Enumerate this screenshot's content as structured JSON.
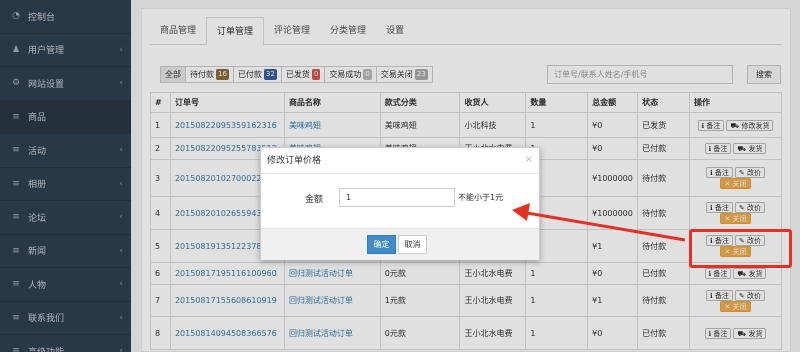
{
  "sidebar": {
    "items": [
      {
        "icon": "◔",
        "label": "控制台",
        "chevron": ""
      },
      {
        "icon": "♟",
        "label": "用户管理",
        "chevron": "‹"
      },
      {
        "icon": "⚙",
        "label": "网站设置",
        "chevron": "‹"
      },
      {
        "icon": "≡",
        "label": "商品",
        "chevron": ""
      },
      {
        "icon": "≡",
        "label": "活动",
        "chevron": "‹"
      },
      {
        "icon": "≡",
        "label": "相册",
        "chevron": "‹"
      },
      {
        "icon": "≡",
        "label": "论坛",
        "chevron": "‹"
      },
      {
        "icon": "≡",
        "label": "新闻",
        "chevron": "‹"
      },
      {
        "icon": "≡",
        "label": "人物",
        "chevron": "‹"
      },
      {
        "icon": "≡",
        "label": "联系我们",
        "chevron": "‹"
      },
      {
        "icon": "≡",
        "label": "高级功能",
        "chevron": "‹"
      }
    ]
  },
  "tabs": [
    "商品管理",
    "订单管理",
    "评论管理",
    "分类管理",
    "设置"
  ],
  "filters": [
    {
      "label": "全部",
      "badge": ""
    },
    {
      "label": "待付款",
      "badge": "16",
      "color": "#8a6d3b"
    },
    {
      "label": "已付款",
      "badge": "32",
      "color": "#3a5f9c"
    },
    {
      "label": "已发货",
      "badge": "0",
      "color": "#d9534f"
    },
    {
      "label": "交易成功",
      "badge": "0",
      "color": "#bbbbbb"
    },
    {
      "label": "交易关闭",
      "badge": "23",
      "color": "#aaaaaa"
    }
  ],
  "search": {
    "placeholder": "订单号/联系人姓名/手机号",
    "button": "搜索"
  },
  "table": {
    "headers": [
      "#",
      "订单号",
      "商品名称",
      "款式分类",
      "收货人",
      "数量",
      "总金额",
      "状态",
      "操作"
    ],
    "rows": [
      {
        "n": "1",
        "order": "20150822095359162316",
        "product": "美味鸡翅",
        "style": "美味鸡翅",
        "receiver": "小北科技",
        "qty": "1",
        "total": "¥0",
        "status": "已发货",
        "ops": [
          "ℹ 备注",
          "⛟ 修改发货"
        ],
        "warn": ""
      },
      {
        "n": "2",
        "order": "20150822095255783512",
        "product": "美味鸡翅",
        "style": "美味鸡翅",
        "receiver": "王小北水电费",
        "qty": "1",
        "total": "¥0",
        "status": "已付款",
        "ops": [
          "ℹ 备注",
          "⛟ 发货"
        ],
        "warn": ""
      },
      {
        "n": "3",
        "order": "20150820102700022618",
        "product": "",
        "style": "",
        "receiver": "",
        "qty": "",
        "total": "¥1000000",
        "status": "待付款",
        "ops": [
          "ℹ 备注",
          "✎ 改价"
        ],
        "warn": "✕ 关闭"
      },
      {
        "n": "4",
        "order": "20150820102655943833",
        "product": "",
        "style": "",
        "receiver": "",
        "qty": "",
        "total": "¥1000000",
        "status": "待付款",
        "ops": [
          "ℹ 备注",
          "✎ 改价"
        ],
        "warn": "✕ 关闭"
      },
      {
        "n": "5",
        "order": "20150819135122378261",
        "product": "",
        "style": "",
        "receiver": "",
        "qty": "",
        "total": "¥1",
        "status": "待付款",
        "ops": [
          "ℹ 备注",
          "✎ 改价"
        ],
        "warn": "✕ 关闭"
      },
      {
        "n": "6",
        "order": "20150817195116100960",
        "product": "回归测试活动订单",
        "style": "0元款",
        "receiver": "王小北水电费",
        "qty": "1",
        "total": "¥0",
        "status": "已付款",
        "ops": [
          "ℹ 备注",
          "⛟ 发货"
        ],
        "warn": ""
      },
      {
        "n": "7",
        "order": "20150817155608610919",
        "product": "回归测试活动订单",
        "style": "1元款",
        "receiver": "王小北水电费",
        "qty": "1",
        "total": "¥1",
        "status": "待付款",
        "ops": [
          "ℹ 备注",
          "✎ 改价"
        ],
        "warn": "✕ 关闭"
      },
      {
        "n": "8",
        "order": "20150814094508366576",
        "product": "回归测试活动订单",
        "style": "0元款",
        "receiver": "王小北水电费",
        "qty": "1",
        "total": "¥0",
        "status": "已付款",
        "ops": [
          "ℹ 备注",
          "⛟ 发货"
        ],
        "warn": ""
      }
    ]
  },
  "modal": {
    "title": "修改订单价格",
    "close": "×",
    "label": "金额",
    "value": "1",
    "hint": "不能小于1元",
    "ok": "确定",
    "cancel": "取消"
  },
  "colors": {
    "sidebar": "#2f4050",
    "annotation": "#e53125",
    "primary": "#428bca",
    "warning": "#f0ad4e"
  }
}
